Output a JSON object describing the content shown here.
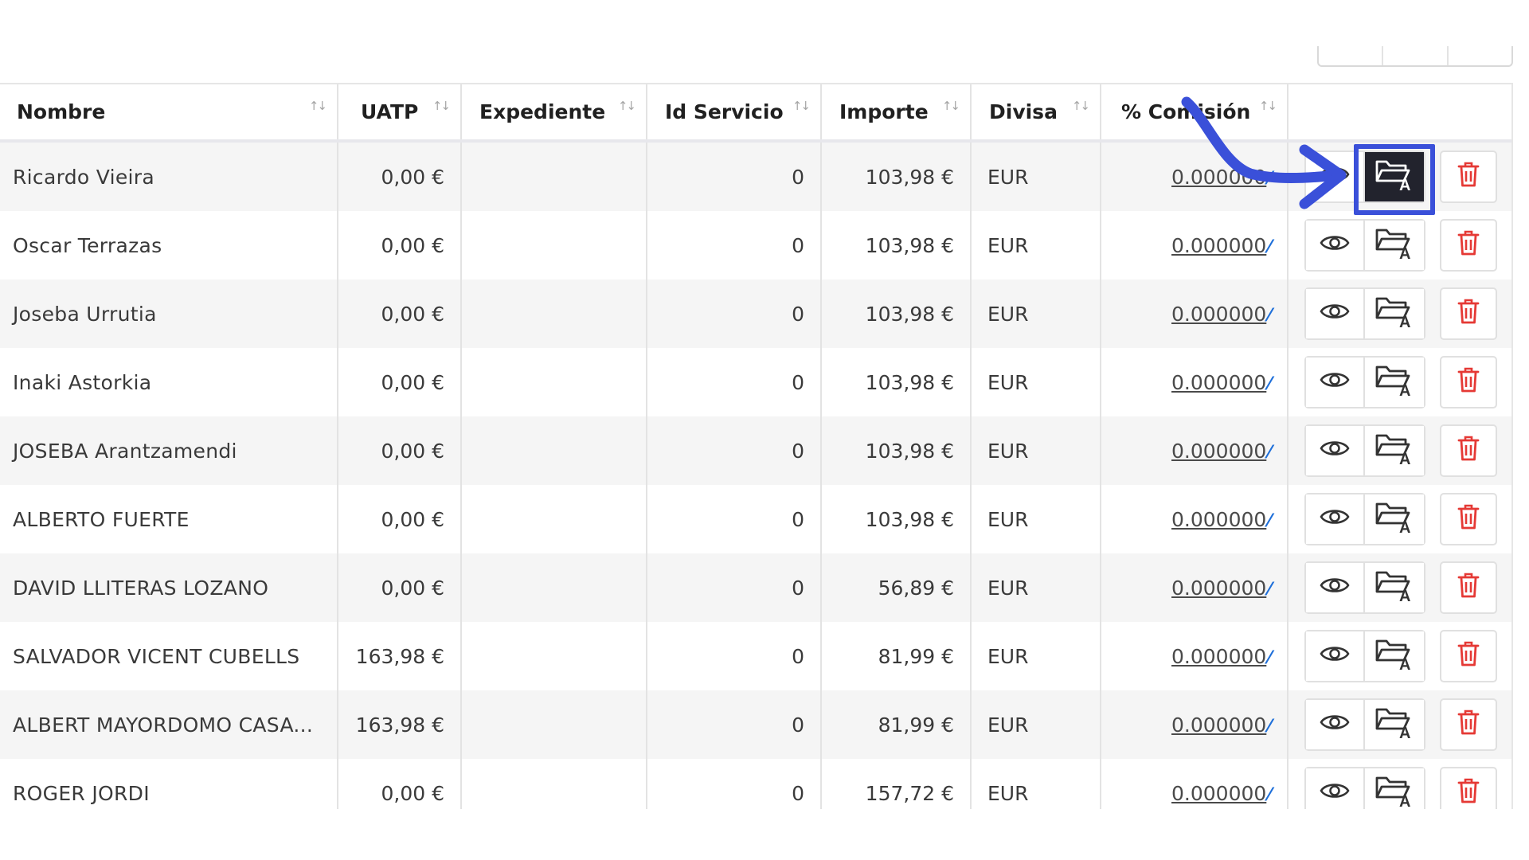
{
  "table": {
    "columns": [
      "Nombre",
      "UATP",
      "Expediente",
      "Id Servicio",
      "Importe",
      "Divisa",
      "% Comisión"
    ],
    "sort_icon": "↑↓",
    "rows": [
      {
        "nombre": "Ricardo Vieira",
        "uatp": "0,00 €",
        "expediente": "",
        "id_servicio": "0",
        "importe": "103,98 €",
        "divisa": "EUR",
        "comision": "0.000000"
      },
      {
        "nombre": "Oscar Terrazas",
        "uatp": "0,00 €",
        "expediente": "",
        "id_servicio": "0",
        "importe": "103,98 €",
        "divisa": "EUR",
        "comision": "0.000000"
      },
      {
        "nombre": "Joseba Urrutia",
        "uatp": "0,00 €",
        "expediente": "",
        "id_servicio": "0",
        "importe": "103,98 €",
        "divisa": "EUR",
        "comision": "0.000000"
      },
      {
        "nombre": "Inaki Astorkia",
        "uatp": "0,00 €",
        "expediente": "",
        "id_servicio": "0",
        "importe": "103,98 €",
        "divisa": "EUR",
        "comision": "0.000000"
      },
      {
        "nombre": "JOSEBA Arantzamendi",
        "uatp": "0,00 €",
        "expediente": "",
        "id_servicio": "0",
        "importe": "103,98 €",
        "divisa": "EUR",
        "comision": "0.000000"
      },
      {
        "nombre": "ALBERTO FUERTE",
        "uatp": "0,00 €",
        "expediente": "",
        "id_servicio": "0",
        "importe": "103,98 €",
        "divisa": "EUR",
        "comision": "0.000000"
      },
      {
        "nombre": "DAVID LLITERAS LOZANO",
        "uatp": "0,00 €",
        "expediente": "",
        "id_servicio": "0",
        "importe": "56,89 €",
        "divisa": "EUR",
        "comision": "0.000000"
      },
      {
        "nombre": "SALVADOR VICENT CUBELLS",
        "uatp": "163,98 €",
        "expediente": "",
        "id_servicio": "0",
        "importe": "81,99 €",
        "divisa": "EUR",
        "comision": "0.000000"
      },
      {
        "nombre": "ALBERT MAYORDOMO CASA...",
        "uatp": "163,98 €",
        "expediente": "",
        "id_servicio": "0",
        "importe": "81,99 €",
        "divisa": "EUR",
        "comision": "0.000000"
      },
      {
        "nombre": "ROGER JORDI",
        "uatp": "0,00 €",
        "expediente": "",
        "id_servicio": "0",
        "importe": "157,72 €",
        "divisa": "EUR",
        "comision": "0.000000"
      }
    ],
    "row_actions": [
      "eye-icon",
      "folder-a-icon",
      "trash-icon"
    ],
    "active_action": {
      "row": 0,
      "action": "folder-a-icon"
    }
  },
  "colors": {
    "accent_annotation": "#3a50d9",
    "delete": "#e53935",
    "active_button": "#22232d",
    "edit_mark": "#1e6fd9"
  },
  "annotation": {
    "type": "arrow-and-box",
    "target": "folder-a-button row 1"
  }
}
